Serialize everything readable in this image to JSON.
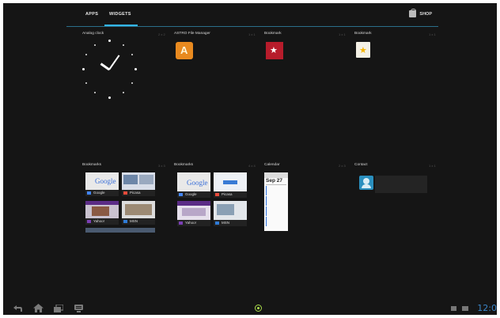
{
  "tabs": [
    "APPS",
    "WIDGETS"
  ],
  "shop_label": "SHOP",
  "widgets": [
    {
      "label": "Analog clock",
      "dims": "2 x 2"
    },
    {
      "label": "ASTRO File Manager",
      "dims": "1 x 1"
    },
    {
      "label": "Bookmark",
      "dims": "1 x 1"
    },
    {
      "label": "Bookmark",
      "dims": "1 x 1"
    },
    {
      "label": "Bookmarks",
      "dims": "3 x 3"
    },
    {
      "label": "Bookmarks",
      "dims": "4 x 4"
    },
    {
      "label": "Calendar",
      "dims": "2 x 3"
    },
    {
      "label": "Contact",
      "dims": "1 x 1"
    }
  ],
  "bookmark_thumbs_1": [
    "Google",
    "Picasa",
    "Yahoo!",
    "MSN"
  ],
  "bookmark_thumbs_2": [
    "Google",
    "Picasa",
    "Yahoo!",
    "MSN"
  ],
  "google_text": "Google",
  "calendar": {
    "date": "Sep 27"
  },
  "clock_time": "12:0",
  "icons": {
    "back": "back-icon",
    "home": "home-icon",
    "recent": "recent-apps-icon",
    "menu": "menu-icon",
    "launcher": "launcher-dot-icon"
  },
  "colors": {
    "accent": "#33b5e5",
    "clock": "#3a86c8",
    "launcher": "#a8d94a"
  }
}
